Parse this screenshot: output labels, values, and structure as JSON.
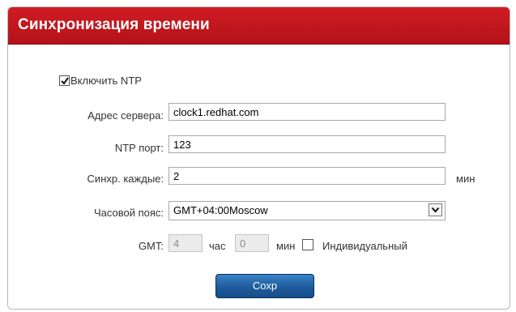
{
  "header": {
    "title": "Синхронизация времени"
  },
  "ntp": {
    "enable_label": "Включить NTP",
    "enabled": true
  },
  "server": {
    "label": "Адрес сервера:",
    "value": "clock1.redhat.com"
  },
  "port": {
    "label": "NTP порт:",
    "value": "123"
  },
  "sync": {
    "label": "Синхр. каждые:",
    "value": "2",
    "unit": "мин"
  },
  "timezone": {
    "label": "Часовой пояс:",
    "value": "GMT+04:00Moscow"
  },
  "gmt": {
    "label": "GMT:",
    "hours_value": "4",
    "hours_unit": "час",
    "minutes_value": "0",
    "minutes_unit": "мин",
    "custom_label": "Индивидуальный",
    "custom_checked": false
  },
  "actions": {
    "save_label": "Сохр"
  }
}
